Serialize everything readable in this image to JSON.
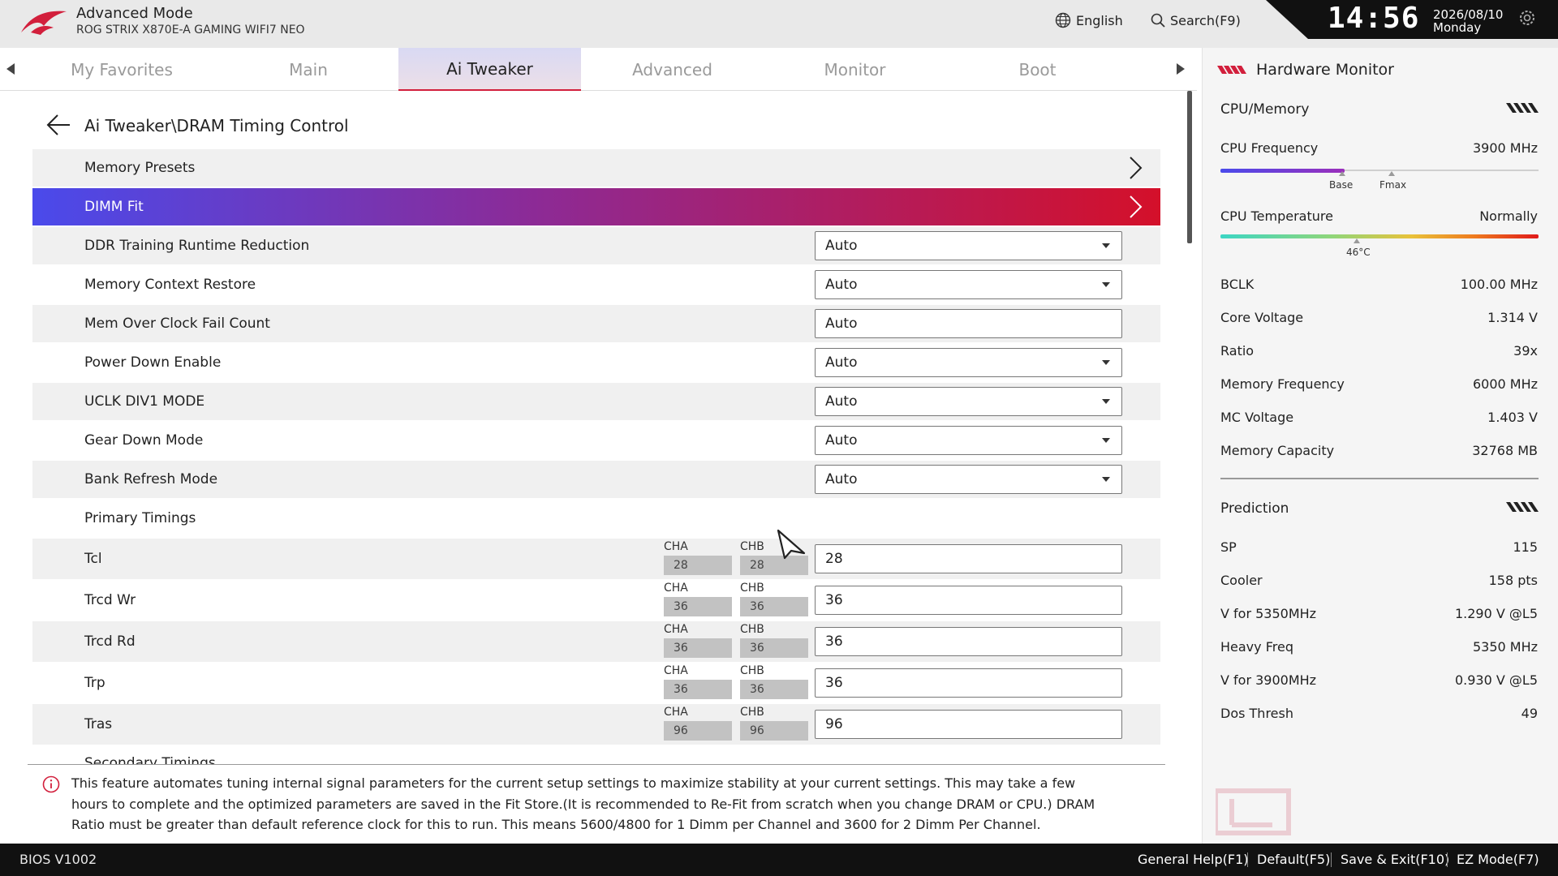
{
  "header": {
    "mode_title": "Advanced Mode",
    "board_name": "ROG STRIX X870E-A GAMING WIFI7 NEO",
    "language_label": "English",
    "search_label": "Search(F9)",
    "time": "14:56",
    "date": "2026/08/10",
    "day": "Monday"
  },
  "tabs": [
    {
      "label": "My Favorites",
      "active": false
    },
    {
      "label": "Main",
      "active": false
    },
    {
      "label": "Ai Tweaker",
      "active": true
    },
    {
      "label": "Advanced",
      "active": false
    },
    {
      "label": "Monitor",
      "active": false
    },
    {
      "label": "Boot",
      "active": false
    }
  ],
  "page": {
    "breadcrumb": "Ai Tweaker\\DRAM Timing Control",
    "rows": [
      {
        "label": "Memory Presets",
        "kind": "submenu"
      },
      {
        "label": "DIMM Fit",
        "kind": "submenu",
        "selected": true
      },
      {
        "label": "DDR Training Runtime Reduction",
        "kind": "select",
        "value": "Auto"
      },
      {
        "label": "Memory Context Restore",
        "kind": "select",
        "value": "Auto"
      },
      {
        "label": "Mem Over Clock Fail Count",
        "kind": "input",
        "value": "Auto"
      },
      {
        "label": "Power Down Enable",
        "kind": "select",
        "value": "Auto"
      },
      {
        "label": "UCLK DIV1 MODE",
        "kind": "select",
        "value": "Auto"
      },
      {
        "label": "Gear Down Mode",
        "kind": "select",
        "value": "Auto"
      },
      {
        "label": "Bank Refresh Mode",
        "kind": "select",
        "value": "Auto"
      },
      {
        "label": "Primary Timings",
        "kind": "header"
      }
    ],
    "channel_labels": {
      "a": "CHA",
      "b": "CHB"
    },
    "timings": [
      {
        "label": "Tcl",
        "cha": "28",
        "chb": "28",
        "value": "28"
      },
      {
        "label": "Trcd Wr",
        "cha": "36",
        "chb": "36",
        "value": "36"
      },
      {
        "label": "Trcd Rd",
        "cha": "36",
        "chb": "36",
        "value": "36"
      },
      {
        "label": "Trp",
        "cha": "36",
        "chb": "36",
        "value": "36"
      },
      {
        "label": "Tras",
        "cha": "96",
        "chb": "96",
        "value": "96"
      }
    ],
    "secondary_partial": "Secondary Timings"
  },
  "help": {
    "text": "This feature automates tuning internal signal parameters for the current setup settings to maximize stability at your current settings. This may take a few hours to complete and the optimized parameters are saved in the Fit Store.(It is recommended to Re-Fit from scratch when you change DRAM or CPU.) DRAM Ratio must be greater than default reference clock for this to run. This means 5600/4800 for 1 Dimm per Channel and 3600 for 2 Dimm Per Channel."
  },
  "hardware_monitor": {
    "title": "Hardware Monitor",
    "cpu_memory": {
      "title": "CPU/Memory",
      "cpu_frequency": {
        "label": "CPU Frequency",
        "value": "3900 MHz",
        "fill_fraction": 0.39,
        "base_label": "Base",
        "fmax_label": "Fmax"
      },
      "cpu_temperature": {
        "label": "CPU Temperature",
        "value": "Normally",
        "marker_label": "46°C"
      },
      "items": [
        {
          "label": "BCLK",
          "value": "100.00 MHz"
        },
        {
          "label": "Core Voltage",
          "value": "1.314 V"
        },
        {
          "label": "Ratio",
          "value": "39x"
        },
        {
          "label": "Memory Frequency",
          "value": "6000 MHz"
        },
        {
          "label": "MC Voltage",
          "value": "1.403 V"
        },
        {
          "label": "Memory Capacity",
          "value": "32768 MB"
        }
      ]
    },
    "prediction": {
      "title": "Prediction",
      "items": [
        {
          "label": "SP",
          "value": "115"
        },
        {
          "label": "Cooler",
          "value": "158 pts"
        },
        {
          "label": "V for 5350MHz",
          "value": "1.290 V @L5"
        },
        {
          "label": "Heavy Freq",
          "value": "5350 MHz"
        },
        {
          "label": "V for 3900MHz",
          "value": "0.930 V @L5"
        },
        {
          "label": "Dos Thresh",
          "value": "49"
        }
      ]
    }
  },
  "footer": {
    "bios_version": "BIOS V1002",
    "actions": [
      {
        "label": "General Help(F1)"
      },
      {
        "label": "Default(F5)"
      },
      {
        "label": "Save & Exit(F10)"
      },
      {
        "label": "EZ Mode(F7)"
      }
    ]
  },
  "colors": {
    "accent_red": "#d21f3c",
    "selected_gradient_start": "#4a4aeb",
    "selected_gradient_end": "#d4102a"
  },
  "icons": {
    "logo": "rog-logo",
    "language": "globe-icon",
    "search": "search-icon",
    "settings": "settings-icon",
    "back": "back-arrow-icon",
    "submenu": "chevron-right-icon",
    "info": "info-icon"
  }
}
